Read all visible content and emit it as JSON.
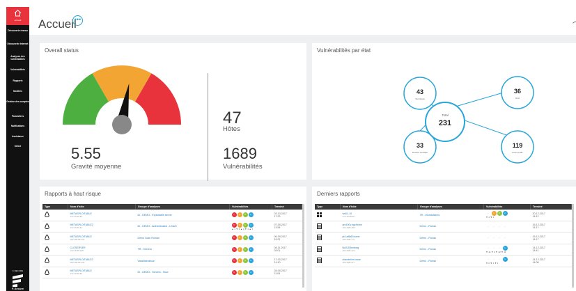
{
  "sidebar": {
    "home_label": "Accueil",
    "items": [
      {
        "label": "Découverte réseau"
      },
      {
        "label": "Découverte Internet"
      },
      {
        "label": "Analyses des vulnérabilités"
      },
      {
        "label": "Vulnérabilités"
      },
      {
        "label": "Rapports"
      },
      {
        "label": "Modèles"
      },
      {
        "label": "Gestion des comptes"
      },
      {
        "label": "Paramètres"
      },
      {
        "label": "Notifications"
      },
      {
        "label": "Assistance"
      },
      {
        "label": "Sélect"
      }
    ],
    "brand_small": "F-SECURE",
    "brand": "F-Secure"
  },
  "header": {
    "title": "Accueil",
    "more_label": "•••"
  },
  "overall": {
    "title": "Overall status",
    "severity": "5.55",
    "severity_label": "Gravité moyenne",
    "severity_level": 0.555,
    "hosts": "47",
    "hosts_label": "Hôtes",
    "vulns": "1689",
    "vulns_label": "Vulnérabilités",
    "colors": {
      "green": "#4caf3f",
      "orange": "#f3a533",
      "red": "#e8323c"
    }
  },
  "vulns_state": {
    "title": "Vulnérabilités par état",
    "total_label": "Total",
    "total": "231",
    "nodes": [
      {
        "value": "43",
        "label": "Terminées"
      },
      {
        "value": "36",
        "label": "Ouvt"
      },
      {
        "value": "33",
        "label": "Devient sensible"
      },
      {
        "value": "119",
        "label": "Accès à ML"
      }
    ]
  },
  "high_risk": {
    "title": "Rapports à haut risque",
    "columns": [
      "Type",
      "Nom d'hôte",
      "Groupe d'analyses",
      "Vulnérabilités",
      "Terminé"
    ],
    "rows": [
      {
        "name": "METASPLOITABLE",
        "ip": "172.16.56.84",
        "group": "ID - DEMO - Exploitable server",
        "counts": [
          "7",
          "3",
          "5",
          "5"
        ],
        "trend": "",
        "date": "03-10-2017",
        "time": "17:23"
      },
      {
        "name": "METASPLOITABLE2",
        "ip": "172.16.56.61",
        "group": "ID - DEMO - Authenticated - LINUX",
        "counts": [
          "6",
          "3",
          "5",
          "4"
        ],
        "trend": "▲ 1 ▼ 2 ▲ 4 ▼ 1 ▲ 1",
        "date": "07-09-2017",
        "time": "13:54"
      },
      {
        "name": "METASPLOITABLE",
        "ip": "192.168.85.131",
        "group": "Demo Scan Roman",
        "counts": [
          "5",
          "3",
          "4",
          "3"
        ],
        "trend": "",
        "date": "06-09-2017",
        "time": "15:21"
      },
      {
        "name": "CLOSERVER",
        "ip": "172.16.58.138",
        "group": "TR - Servers",
        "counts": [
          "5",
          "2",
          "5",
          "2"
        ],
        "trend": "",
        "date": "08-11-2017",
        "time": "03:01"
      },
      {
        "name": "METASPLOITABLE2",
        "ip": "192.168.85.129",
        "group": "Vassiltstruktuur",
        "counts": [
          "5",
          "3",
          "4",
          "3"
        ],
        "trend": "",
        "date": "17-03-2017",
        "time": "14:10"
      },
      {
        "name": "METASPLOITABLE",
        "ip": "172.16.56.84",
        "group": "ID - DEMO - Servers - Slow",
        "counts": [
          "6",
          "3",
          "5",
          "4"
        ],
        "trend": "",
        "date": "28-09-2017",
        "time": "11:04"
      }
    ]
  },
  "latest": {
    "title": "Derniers rapports",
    "columns": [
      "Type",
      "Nom d'hôte",
      "Groupe d'analyses",
      "Vulnérabilités",
      "Terminé"
    ],
    "rows": [
      {
        "type": "windows-icon",
        "name": "ws01-10",
        "ip": "172.16.58.30",
        "group": "TR - Workstations",
        "counts": [
          "",
          "1",
          "2",
          "2"
        ],
        "trend": "▼ 1 ▼ 1",
        "date": "20-12-2017",
        "time": "14:12"
      },
      {
        "type": "server-icon",
        "name": "am100v.ngchome",
        "ip": "192.168.1.88",
        "group": "Demo - Florian",
        "counts": [
          "",
          "",
          "",
          ""
        ],
        "trend": "",
        "date": "15-12-2017",
        "time": "14:17"
      },
      {
        "type": "server-icon",
        "name": "pi4-a8b6f.home",
        "ip": "192.168.1.70",
        "group": "Demo - Florian",
        "counts": [
          "",
          "",
          "",
          ""
        ],
        "trend": "",
        "date": "15-12-2017",
        "time": "14:17"
      },
      {
        "type": "server-icon",
        "name": "NAS-Ellenborg",
        "ip": "192.168.1.45",
        "group": "Demo - Florian",
        "counts": [
          "",
          "",
          "",
          "1"
        ],
        "trend": "▼ 11 ▼ 2 ▼ 12 ▼ 11",
        "date": "14-12-2017",
        "time": "14:41"
      },
      {
        "type": "server-icon",
        "name": "chandelier.home",
        "ip": "192.168.1.47",
        "group": "Demo - Florian",
        "counts": [
          "",
          "",
          "",
          "1"
        ],
        "trend": "▼ 2 ▼ 1 ▼ 1",
        "date": "14-12-2017",
        "time": "14:08"
      }
    ]
  }
}
